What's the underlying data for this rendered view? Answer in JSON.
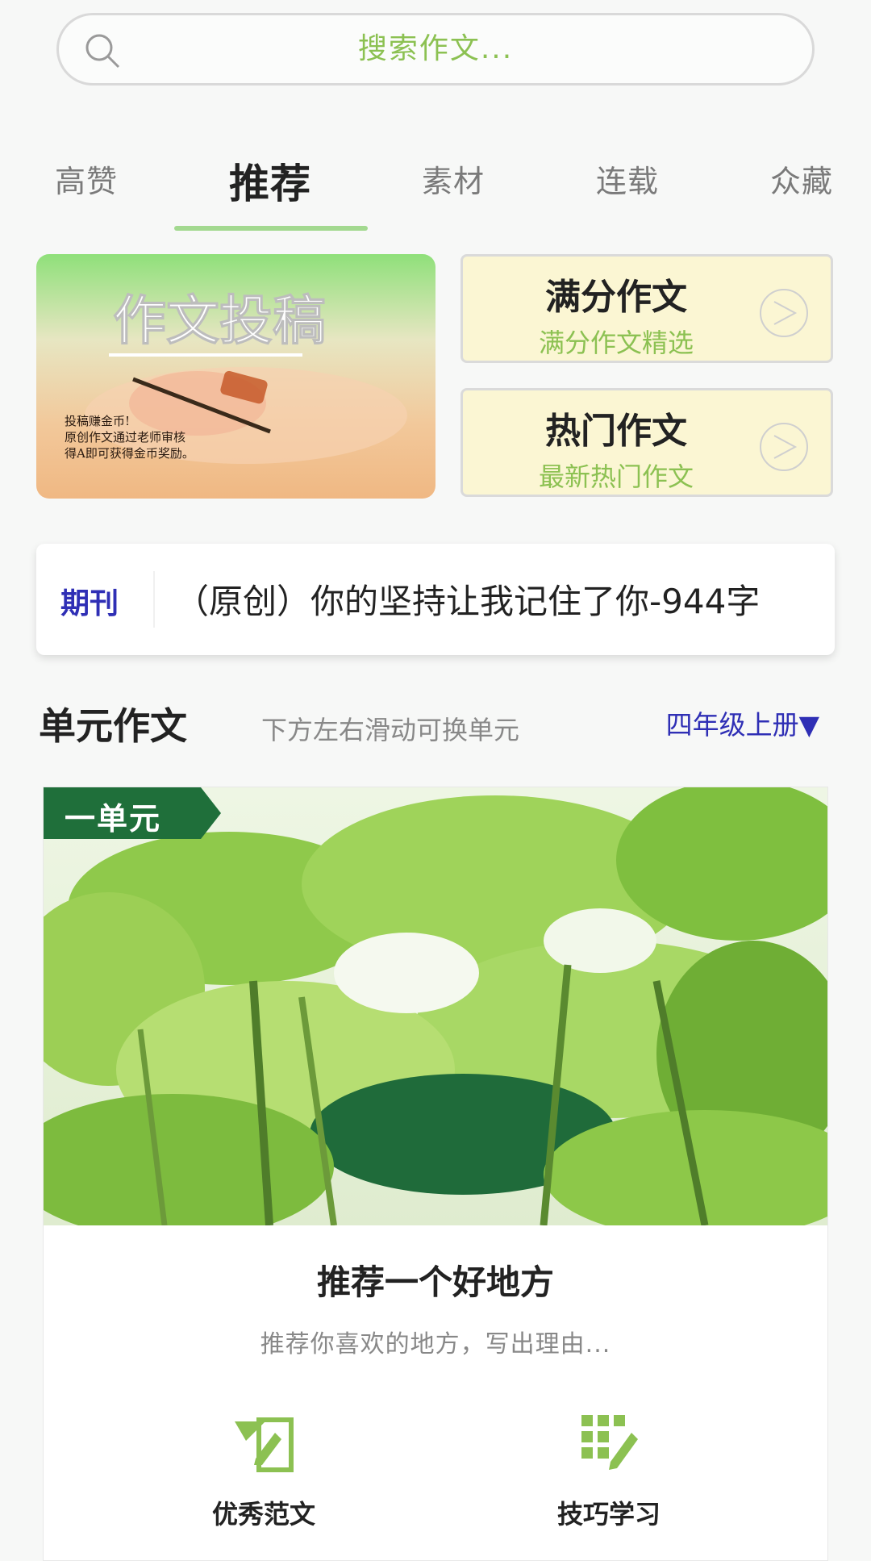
{
  "search": {
    "placeholder": "搜索作文..."
  },
  "tabs": [
    {
      "label": "高赞"
    },
    {
      "label": "推荐",
      "active": true
    },
    {
      "label": "素材"
    },
    {
      "label": "连载"
    },
    {
      "label": "众藏"
    }
  ],
  "banner": {
    "title": "作文投稿",
    "note_line1": "投稿赚金币!",
    "note_line2": "原创作文通过老师审核",
    "note_line3": "得A即可获得金币奖励。"
  },
  "features": [
    {
      "title": "满分作文",
      "subtitle": "满分作文精选"
    },
    {
      "title": "热门作文",
      "subtitle": "最新热门作文"
    }
  ],
  "notice": {
    "tag": "期刊",
    "text": "（原创）你的坚持让我记住了你-944字"
  },
  "unit_section": {
    "title": "单元作文",
    "hint": "下方左右滑动可换单元",
    "grade": "四年级上册▼"
  },
  "unit_card": {
    "tag": "一单元",
    "title": "推荐一个好地方",
    "desc": "推荐你喜欢的地方，写出理由...",
    "actions": [
      {
        "label": "优秀范文",
        "icon": "essay-edit-icon"
      },
      {
        "label": "技巧学习",
        "icon": "grid-pencil-icon"
      }
    ]
  },
  "colors": {
    "accent_green": "#8cc152",
    "link_blue": "#2f2fb5",
    "feature_bg": "#fbf6d3"
  }
}
